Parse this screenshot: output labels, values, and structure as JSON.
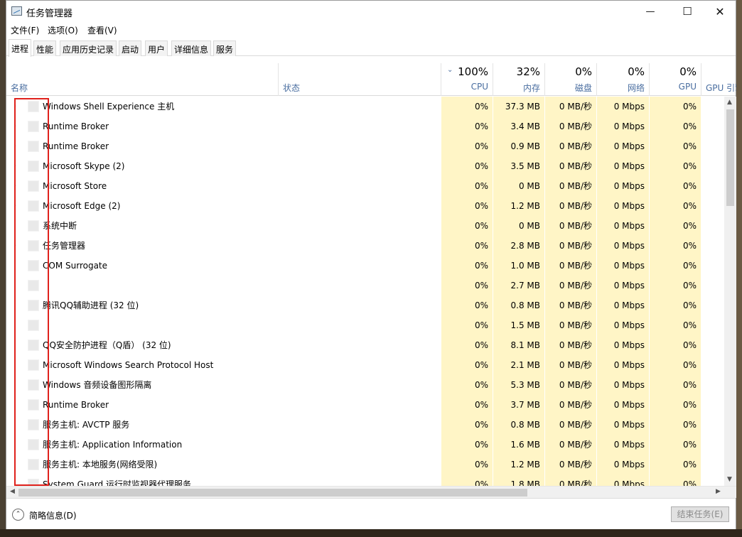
{
  "window": {
    "title": "任务管理器"
  },
  "window_controls": {
    "minimize": "—",
    "maximize": "☐",
    "close": "✕"
  },
  "menu": [
    "文件(F)",
    "选项(O)",
    "查看(V)"
  ],
  "tabs": [
    "进程",
    "性能",
    "应用历史记录",
    "启动",
    "用户",
    "详细信息",
    "服务"
  ],
  "active_tab": "进程",
  "columns": {
    "name": "名称",
    "status": "状态",
    "cpu": {
      "pct": "100%",
      "label": "CPU"
    },
    "memory": {
      "pct": "32%",
      "label": "内存"
    },
    "disk": {
      "pct": "0%",
      "label": "磁盘"
    },
    "network": {
      "pct": "0%",
      "label": "网络"
    },
    "gpu": {
      "pct": "0%",
      "label": "GPU"
    },
    "gpu_engine": "GPU 引擎"
  },
  "processes": [
    {
      "name": "Windows Shell Experience 主机",
      "expand": true,
      "cpu": "0%",
      "mem": "37.3 MB",
      "disk": "0 MB/秒",
      "net": "0 Mbps",
      "gpu": "0%"
    },
    {
      "name": "Runtime Broker",
      "expand": true,
      "cpu": "0%",
      "mem": "3.4 MB",
      "disk": "0 MB/秒",
      "net": "0 Mbps",
      "gpu": "0%"
    },
    {
      "name": "Runtime Broker",
      "expand": true,
      "cpu": "0%",
      "mem": "0.9 MB",
      "disk": "0 MB/秒",
      "net": "0 Mbps",
      "gpu": "0%"
    },
    {
      "name": "Microsoft Skype (2)",
      "expand": true,
      "cpu": "0%",
      "mem": "3.5 MB",
      "disk": "0 MB/秒",
      "net": "0 Mbps",
      "gpu": "0%"
    },
    {
      "name": "Microsoft Store",
      "expand": true,
      "cpu": "0%",
      "mem": "0 MB",
      "disk": "0 MB/秒",
      "net": "0 Mbps",
      "gpu": "0%"
    },
    {
      "name": "Microsoft Edge (2)",
      "expand": true,
      "cpu": "0%",
      "mem": "1.2 MB",
      "disk": "0 MB/秒",
      "net": "0 Mbps",
      "gpu": "0%"
    },
    {
      "name": "系统中断",
      "expand": false,
      "cpu": "0%",
      "mem": "0 MB",
      "disk": "0 MB/秒",
      "net": "0 Mbps",
      "gpu": "0%"
    },
    {
      "name": "任务管理器",
      "expand": true,
      "cpu": "0%",
      "mem": "2.8 MB",
      "disk": "0 MB/秒",
      "net": "0 Mbps",
      "gpu": "0%"
    },
    {
      "name": "COM Surrogate",
      "expand": false,
      "cpu": "0%",
      "mem": "1.0 MB",
      "disk": "0 MB/秒",
      "net": "0 Mbps",
      "gpu": "0%"
    },
    {
      "name": "",
      "expand": false,
      "cpu": "0%",
      "mem": "2.7 MB",
      "disk": "0 MB/秒",
      "net": "0 Mbps",
      "gpu": "0%"
    },
    {
      "name": "腾讯QQ辅助进程 (32 位)",
      "expand": false,
      "cpu": "0%",
      "mem": "0.8 MB",
      "disk": "0 MB/秒",
      "net": "0 Mbps",
      "gpu": "0%"
    },
    {
      "name": "",
      "expand": false,
      "cpu": "0%",
      "mem": "1.5 MB",
      "disk": "0 MB/秒",
      "net": "0 Mbps",
      "gpu": "0%"
    },
    {
      "name": "QQ安全防护进程（Q盾） (32 位)",
      "expand": false,
      "cpu": "0%",
      "mem": "8.1 MB",
      "disk": "0 MB/秒",
      "net": "0 Mbps",
      "gpu": "0%"
    },
    {
      "name": "Microsoft Windows Search Protocol Host",
      "expand": false,
      "cpu": "0%",
      "mem": "2.1 MB",
      "disk": "0 MB/秒",
      "net": "0 Mbps",
      "gpu": "0%"
    },
    {
      "name": "Windows 音频设备图形隔离",
      "expand": false,
      "cpu": "0%",
      "mem": "5.3 MB",
      "disk": "0 MB/秒",
      "net": "0 Mbps",
      "gpu": "0%"
    },
    {
      "name": "Runtime Broker",
      "expand": false,
      "cpu": "0%",
      "mem": "3.7 MB",
      "disk": "0 MB/秒",
      "net": "0 Mbps",
      "gpu": "0%"
    },
    {
      "name": "服务主机: AVCTP 服务",
      "expand": false,
      "cpu": "0%",
      "mem": "0.8 MB",
      "disk": "0 MB/秒",
      "net": "0 Mbps",
      "gpu": "0%"
    },
    {
      "name": "服务主机: Application Information",
      "expand": false,
      "cpu": "0%",
      "mem": "1.6 MB",
      "disk": "0 MB/秒",
      "net": "0 Mbps",
      "gpu": "0%"
    },
    {
      "name": "服务主机: 本地服务(网络受限)",
      "expand": false,
      "cpu": "0%",
      "mem": "1.2 MB",
      "disk": "0 MB/秒",
      "net": "0 Mbps",
      "gpu": "0%"
    },
    {
      "name": "System Guard 运行时监视器代理服务",
      "expand": false,
      "cpu": "0%",
      "mem": "1.8 MB",
      "disk": "0 MB/秒",
      "net": "0 Mbps",
      "gpu": "0%"
    }
  ],
  "footer": {
    "fewer_details": "简略信息(D)",
    "end_task": "结束任务(E)"
  },
  "colors": {
    "highlight": "#e0211c",
    "usage_bg": "#fff5c6",
    "header_label": "#4a6ea0"
  }
}
